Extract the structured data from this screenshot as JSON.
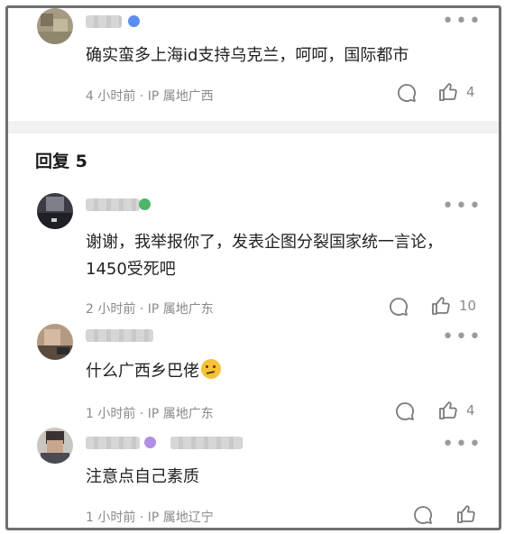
{
  "top_comment": {
    "text": "确实蛮多上海id支持乌克兰，呵呵，国际都市",
    "meta": "4 小时前 · IP 属地广西",
    "like_count": "4",
    "colors": {
      "badge": "#5b8def"
    }
  },
  "replies_section": {
    "title": "回复 5"
  },
  "replies": [
    {
      "text": "谢谢，我举报你了，发表企图分裂国家统一言论，1450受死吧",
      "meta": "2 小时前 · IP 属地广东",
      "like_count": "10",
      "badge_color": "#4fb56a"
    },
    {
      "text": "什么广西乡巴佬",
      "emoji": "thinking-face",
      "meta": "1 小时前 · IP 属地广东",
      "like_count": "4"
    },
    {
      "text": "注意点自己素质",
      "meta": "1 小时前 · IP 属地辽宁",
      "like_count": ""
    }
  ],
  "icons": {
    "more": "more-dots-icon",
    "reply": "comment-bubble-icon",
    "like": "thumbs-up-icon"
  },
  "colors": {
    "meta_text": "#8a8a8a",
    "divider": "#f1f1f1",
    "icon_stroke": "#7a7a7a"
  }
}
